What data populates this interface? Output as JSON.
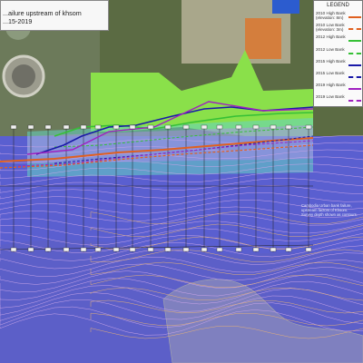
{
  "map": {
    "title_lines": [
      "...ailure upstream of khsom",
      "...15-2019"
    ],
    "legend_title": "LEGEND",
    "legend": [
      {
        "label": "2010 High Bank (elevation: 8m)",
        "color": "#e06020",
        "dash": "solid"
      },
      {
        "label": "2010 Low Bank (elevation: 3m)",
        "color": "#e06020",
        "dash": "dashed"
      },
      {
        "label": "2012 High Bank",
        "color": "#36c036",
        "dash": "solid"
      },
      {
        "label": "2012 Low Bank",
        "color": "#36c036",
        "dash": "dashed"
      },
      {
        "label": "2015 High Bank",
        "color": "#1a1aa8",
        "dash": "solid"
      },
      {
        "label": "2015 Low Bank",
        "color": "#1a1aa8",
        "dash": "dashed"
      },
      {
        "label": "2019 High Bank",
        "color": "#a020c0",
        "dash": "solid"
      },
      {
        "label": "2019 Low Bank",
        "color": "#a020c0",
        "dash": "dashed"
      }
    ],
    "note": "Cambodia Urban bank failure, upstream factors of Khsom. Survey depth shown as contours.",
    "colors": {
      "water": "#5a5fd0",
      "aerial": "#5b6b43",
      "bank_fill": "#8ae04a",
      "contour": "#c9a4e8"
    }
  }
}
